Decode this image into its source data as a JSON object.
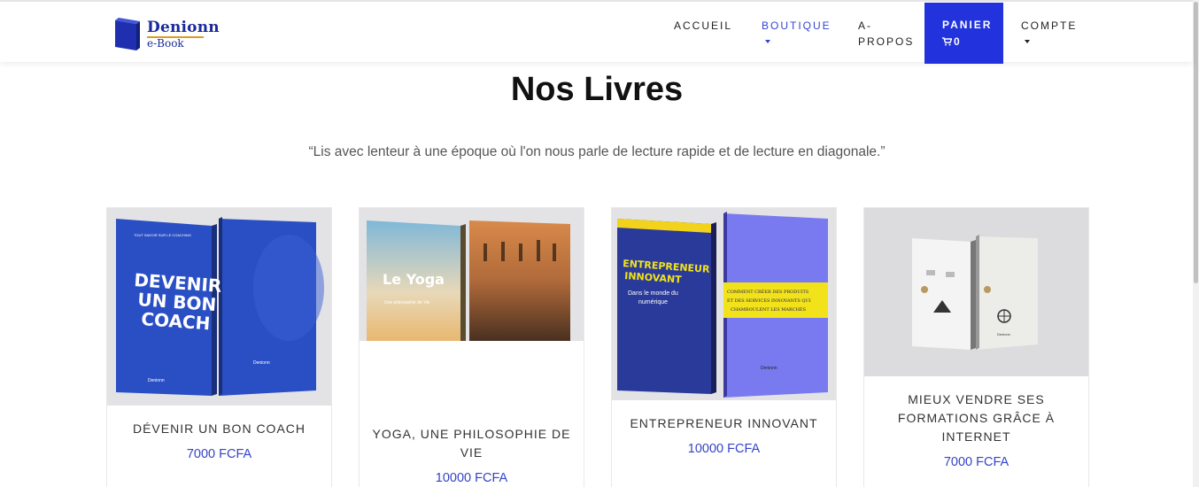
{
  "brand": {
    "name": "Denionn",
    "sub": "e-Book"
  },
  "nav": {
    "accueil": "ACCUEIL",
    "boutique": "BOUTIQUE",
    "apropos": "A-PROPOS",
    "panier": "PANIER",
    "cart_count": "0",
    "compte": "COMPTE"
  },
  "colors": {
    "accent": "#2233dd",
    "price": "#3344c8"
  },
  "section": {
    "title": "Nos Livres",
    "quote": "“Lis avec lenteur à une époque où l'on nous parle de lecture rapide et de lecture en diagonale.”"
  },
  "books": [
    {
      "title": "DÉVENIR UN BON COACH",
      "price": "7000 FCFA",
      "cover_text": [
        "DEVENIR",
        "UN BON",
        "COACH"
      ],
      "cover_top": "TOUT SAVOIR SUR LE COACHING",
      "cover_brand": "Denionn"
    },
    {
      "title": "YOGA, UNE PHILOSOPHIE DE VIE",
      "price": "10000 FCFA",
      "cover_text": [
        "Le Yoga"
      ],
      "cover_sub": "Une philosophie de Vie"
    },
    {
      "title": "ENTREPRENEUR INNOVANT",
      "price": "10000 FCFA",
      "cover_text": [
        "ENTREPRENEUR",
        "INNOVANT"
      ],
      "cover_sub": [
        "Dans le monde du",
        "numérique"
      ],
      "cover_back": [
        "COMMENT CRÉER DES PRODUITS",
        "ET DES SERVICES INNOVANTS QUI",
        "CHAMBOULENT LES MARCHÉS"
      ],
      "cover_brand": "Denionn"
    },
    {
      "title": "MIEUX VENDRE SES FORMATIONS GRÂCE À INTERNET",
      "price": "7000 FCFA",
      "cover_brand": "Denionn"
    }
  ]
}
